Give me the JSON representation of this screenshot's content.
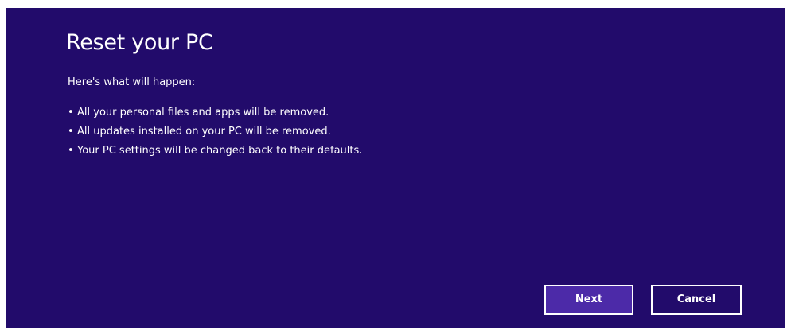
{
  "dialog": {
    "title": "Reset your PC",
    "subtitle": "Here's what will happen:",
    "bullets": [
      "All your personal files and apps will be removed.",
      "All updates installed on your PC will be removed.",
      "Your PC settings will be changed back to their defaults."
    ],
    "bullet_glyph": "•",
    "buttons": {
      "next_label": "Next",
      "cancel_label": "Cancel"
    }
  },
  "colors": {
    "background": "#220b6b",
    "primary_button": "#4c2aa8",
    "text": "#ffffff"
  }
}
